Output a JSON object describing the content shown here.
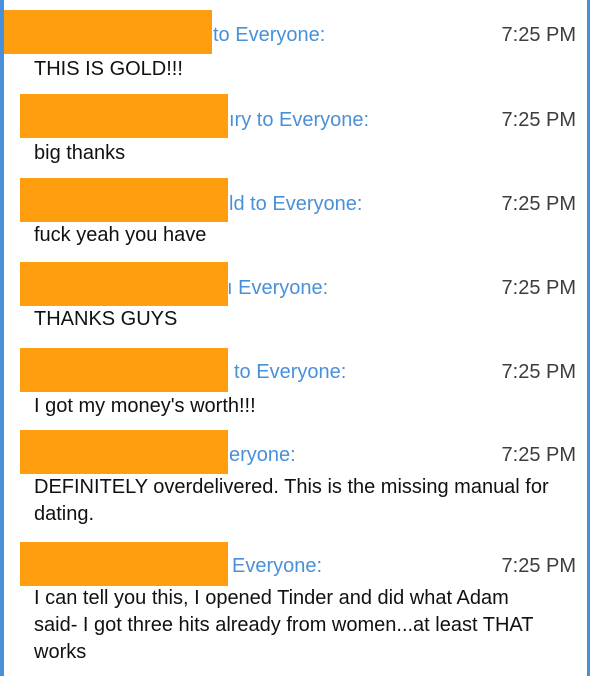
{
  "colors": {
    "accent_blue": "#4a90d9",
    "redaction_orange": "#ff9f10",
    "time_gray": "#3d3d3d",
    "text_black": "#111111"
  },
  "messages": [
    {
      "sender_visible": "to Everyone:",
      "time": "7:25 PM",
      "text": "THIS IS GOLD!!!"
    },
    {
      "sender_visible": "ıry to Everyone:",
      "time": "7:25 PM",
      "text": "big thanks"
    },
    {
      "sender_visible": "ld to Everyone:",
      "time": "7:25 PM",
      "text": "fuck yeah you have"
    },
    {
      "sender_visible": "ı Everyone:",
      "time": "7:25 PM",
      "text": "THANKS GUYS"
    },
    {
      "sender_visible": "to Everyone:",
      "time": "7:25 PM",
      "text": "I got my money's worth!!!"
    },
    {
      "sender_visible": "eryone:",
      "time": "7:25 PM",
      "text": "DEFINITELY overdelivered. This is the missing manual for dating."
    },
    {
      "sender_visible": "Everyone:",
      "time": "7:25 PM",
      "text": "I can tell you this, I opened Tinder and did what Adam said- I got three hits already from women...at least THAT works"
    }
  ]
}
